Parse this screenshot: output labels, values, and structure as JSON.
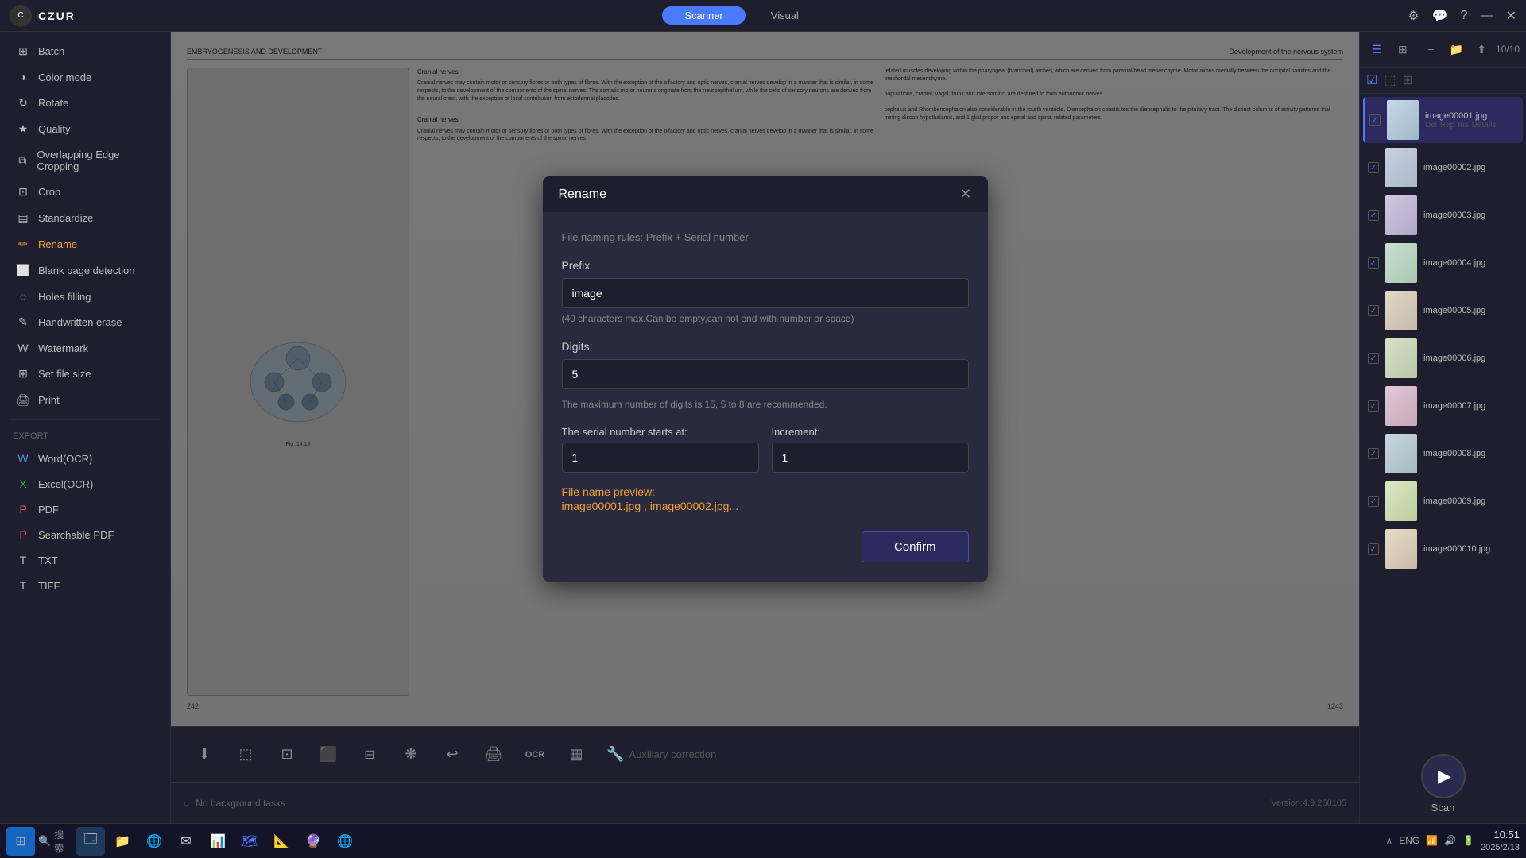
{
  "app": {
    "brand": "CZUR",
    "logo_text": "C"
  },
  "titlebar": {
    "tabs": [
      {
        "id": "scanner",
        "label": "Scanner",
        "active": true
      },
      {
        "id": "visual",
        "label": "Visual",
        "active": false
      }
    ],
    "controls": {
      "settings_icon": "⚙",
      "chat_icon": "💬",
      "help_icon": "?",
      "minimize_icon": "—",
      "close_icon": "✕"
    }
  },
  "sidebar": {
    "items": [
      {
        "id": "batch",
        "label": "Batch",
        "icon": "⊞",
        "active": false
      },
      {
        "id": "color-mode",
        "label": "Color mode",
        "icon": "◑",
        "active": false
      },
      {
        "id": "rotate",
        "label": "Rotate",
        "icon": "↻",
        "active": false
      },
      {
        "id": "quality",
        "label": "Quality",
        "icon": "★",
        "active": false
      },
      {
        "id": "overlapping-edge",
        "label": "Overlapping Edge Cropping",
        "icon": "⧉",
        "active": false
      },
      {
        "id": "crop",
        "label": "Crop",
        "icon": "⊡",
        "active": false
      },
      {
        "id": "standardize",
        "label": "Standardize",
        "icon": "▤",
        "active": false
      },
      {
        "id": "rename",
        "label": "Rename",
        "icon": "✏",
        "active": true
      },
      {
        "id": "blank-page",
        "label": "Blank page detection",
        "icon": "⬜",
        "active": false
      },
      {
        "id": "holes-filling",
        "label": "Holes filling",
        "icon": "◌",
        "active": false
      },
      {
        "id": "handwritten-erase",
        "label": "Handwritten erase",
        "icon": "✎",
        "active": false
      },
      {
        "id": "watermark",
        "label": "Watermark",
        "icon": "W",
        "active": false
      },
      {
        "id": "set-file-size",
        "label": "Set file size",
        "icon": "⊞",
        "active": false
      },
      {
        "id": "print",
        "label": "Print",
        "icon": "🖨",
        "active": false
      }
    ],
    "export_section": "Export",
    "export_items": [
      {
        "id": "word-ocr",
        "label": "Word(OCR)",
        "icon": "W"
      },
      {
        "id": "excel-ocr",
        "label": "Excel(OCR)",
        "icon": "X"
      },
      {
        "id": "pdf",
        "label": "PDF",
        "icon": "P"
      },
      {
        "id": "searchable-pdf",
        "label": "Searchable PDF",
        "icon": "P"
      },
      {
        "id": "txt",
        "label": "TXT",
        "icon": "T"
      },
      {
        "id": "tiff",
        "label": "TIFF",
        "icon": "T"
      }
    ]
  },
  "document": {
    "left_header": "EMBRYOGENESIS AND DEVELOPMENT",
    "right_header": "Development of the nervous system",
    "page_left": "242",
    "page_right": "1243"
  },
  "toolbar_bottom": {
    "tools": [
      {
        "id": "insert",
        "icon": "⬇",
        "label": "Insert"
      },
      {
        "id": "select",
        "icon": "⬚",
        "label": "Select"
      },
      {
        "id": "crop-tool",
        "icon": "⊡",
        "label": "Crop"
      },
      {
        "id": "split",
        "icon": "⬛",
        "label": "Split"
      },
      {
        "id": "adjust",
        "icon": "⊟",
        "label": "Adjust"
      },
      {
        "id": "combine",
        "icon": "❋",
        "label": "Combine"
      },
      {
        "id": "undo",
        "icon": "↩",
        "label": "Undo"
      },
      {
        "id": "print-tool",
        "icon": "🖨",
        "label": "Print"
      },
      {
        "id": "ocr",
        "icon": "OCR",
        "label": "OCR"
      },
      {
        "id": "qr",
        "icon": "▦",
        "label": "QR"
      }
    ],
    "aux_correction_label": "Auxiliary correction"
  },
  "status_bar": {
    "no_tasks_icon": "○",
    "no_tasks_label": "No background tasks",
    "version_label": "Version:4.9.250105"
  },
  "right_panel": {
    "page_count": "10/10",
    "view_mode_icons": [
      "list",
      "grid"
    ],
    "action_icons": [
      "+",
      "folder",
      "export"
    ],
    "thumbnails": [
      {
        "id": 1,
        "name": "image00001.jpg",
        "selected": true,
        "actions": [
          "Del",
          "Rep",
          "Ins",
          "Details"
        ]
      },
      {
        "id": 2,
        "name": "image00002.jpg",
        "selected": false,
        "actions": []
      },
      {
        "id": 3,
        "name": "image00003.jpg",
        "selected": false,
        "actions": []
      },
      {
        "id": 4,
        "name": "image00004.jpg",
        "selected": false,
        "actions": []
      },
      {
        "id": 5,
        "name": "image00005.jpg",
        "selected": false,
        "actions": []
      },
      {
        "id": 6,
        "name": "image00006.jpg",
        "selected": false,
        "actions": []
      },
      {
        "id": 7,
        "name": "image00007.jpg",
        "selected": false,
        "actions": []
      },
      {
        "id": 8,
        "name": "image00008.jpg",
        "selected": false,
        "actions": []
      },
      {
        "id": 9,
        "name": "image00009.jpg",
        "selected": false,
        "actions": []
      },
      {
        "id": 10,
        "name": "image000010.jpg",
        "selected": false,
        "actions": []
      }
    ]
  },
  "scan_button": {
    "icon": "▶",
    "label": "Scan"
  },
  "modal": {
    "title": "Rename",
    "close_icon": "✕",
    "hint": "File naming rules: Prefix + Serial number",
    "prefix_label": "Prefix",
    "prefix_value": "image",
    "prefix_hint": "(40 characters max.Can be empty,can not end with number or space)",
    "digits_label": "Digits:",
    "digits_value": "5",
    "digits_hint": "The maximum number of digits is 15, 5 to 8 are recommended.",
    "serial_label": "The serial number starts at:",
    "serial_value": "1",
    "increment_label": "Increment:",
    "increment_value": "1",
    "preview_label": "File name preview:",
    "preview_value": "image00001.jpg , image00002.jpg...",
    "confirm_label": "Confirm"
  },
  "taskbar": {
    "start_icon": "⊞",
    "search_placeholder": "搜索",
    "apps": [
      "🗔",
      "📁",
      "🌐",
      "📧",
      "🗒",
      "📊"
    ],
    "systray": {
      "lang": "ENG",
      "volume_icon": "🔊",
      "wifi_icon": "📶",
      "time": "10:51",
      "date": "2025/2/13"
    }
  }
}
